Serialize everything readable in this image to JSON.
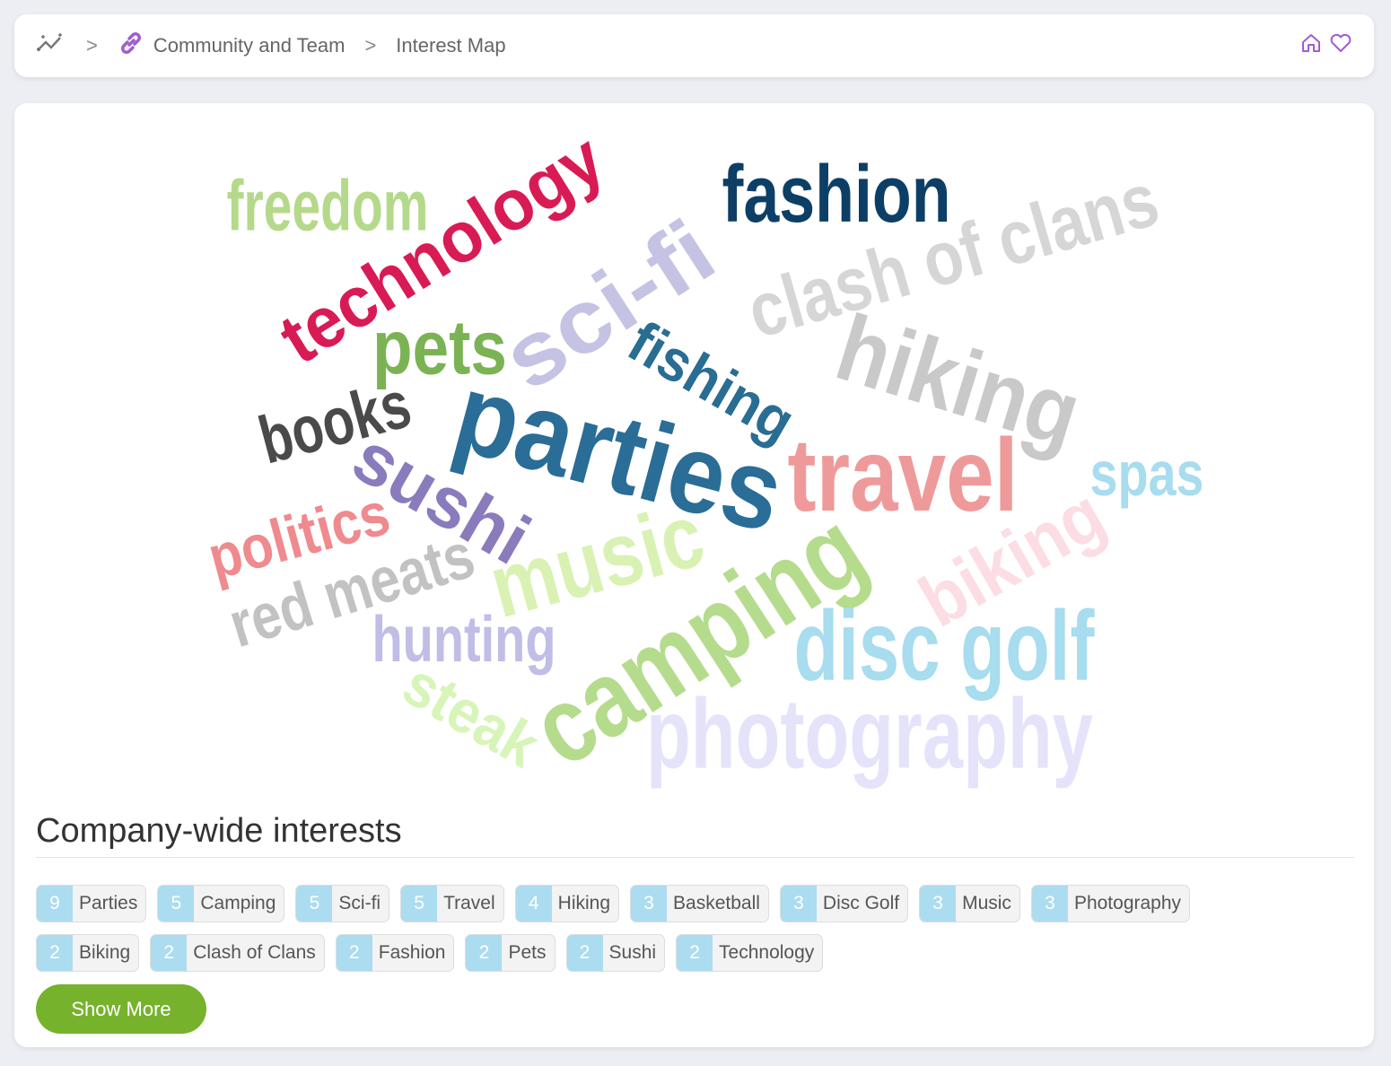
{
  "breadcrumb": {
    "items": [
      "Community and Team",
      "Interest Map"
    ],
    "separator": ">"
  },
  "header_icons": [
    "analytics-icon",
    "link-icon",
    "home-icon",
    "heart-icon"
  ],
  "accent_color": "#a35bd6",
  "word_cloud": [
    {
      "text": "freedom",
      "color": "#b5d98a"
    },
    {
      "text": "technology",
      "color": "#d81b55"
    },
    {
      "text": "fashion",
      "color": "#0d3f66"
    },
    {
      "text": "clash of clans",
      "color": "#d6d6d6"
    },
    {
      "text": "sci-fi",
      "color": "#c5c3e3"
    },
    {
      "text": "pets",
      "color": "#7bb354"
    },
    {
      "text": "fishing",
      "color": "#2a6d92"
    },
    {
      "text": "hiking",
      "color": "#c9c9c9"
    },
    {
      "text": "books",
      "color": "#4a4a4a"
    },
    {
      "text": "parties",
      "color": "#2a6d96"
    },
    {
      "text": "travel",
      "color": "#ef9a9a"
    },
    {
      "text": "spas",
      "color": "#a8dcef"
    },
    {
      "text": "sushi",
      "color": "#8a7bbd"
    },
    {
      "text": "politics",
      "color": "#ef8a8e"
    },
    {
      "text": "red meats",
      "color": "#c2c2c2"
    },
    {
      "text": "music",
      "color": "#d9f2b4"
    },
    {
      "text": "biking",
      "color": "#fbdde3"
    },
    {
      "text": "camping",
      "color": "#b5dc8d"
    },
    {
      "text": "disc golf",
      "color": "#a8dcef"
    },
    {
      "text": "hunting",
      "color": "#c0bde6"
    },
    {
      "text": "steak",
      "color": "#d7f5b8"
    },
    {
      "text": "photography",
      "color": "#e5e3fa"
    }
  ],
  "interests": {
    "title": "Company-wide interests",
    "tags": [
      {
        "count": "9",
        "label": "Parties"
      },
      {
        "count": "5",
        "label": "Camping"
      },
      {
        "count": "5",
        "label": "Sci-fi"
      },
      {
        "count": "5",
        "label": "Travel"
      },
      {
        "count": "4",
        "label": "Hiking"
      },
      {
        "count": "3",
        "label": "Basketball"
      },
      {
        "count": "3",
        "label": "Disc Golf"
      },
      {
        "count": "3",
        "label": "Music"
      },
      {
        "count": "3",
        "label": "Photography"
      },
      {
        "count": "2",
        "label": "Biking"
      },
      {
        "count": "2",
        "label": "Clash of Clans"
      },
      {
        "count": "2",
        "label": "Fashion"
      },
      {
        "count": "2",
        "label": "Pets"
      },
      {
        "count": "2",
        "label": "Sushi"
      },
      {
        "count": "2",
        "label": "Technology"
      }
    ],
    "show_more": "Show More",
    "show_more_color": "#76b22c"
  }
}
